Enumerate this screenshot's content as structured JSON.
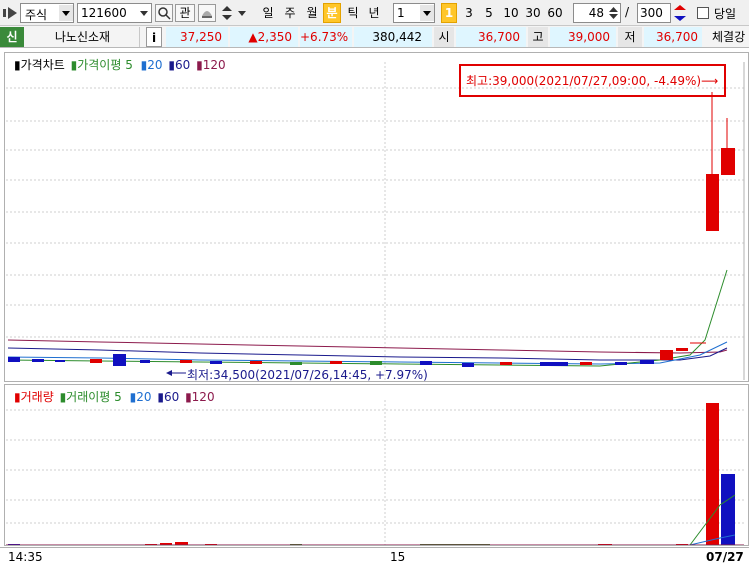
{
  "toolbar": {
    "market_type": "주식",
    "code": "121600",
    "interest_label": "관",
    "period_buttons": [
      "일",
      "주",
      "월",
      "분",
      "틱",
      "년"
    ],
    "active_period": "분",
    "interval_value": "1",
    "quick_intervals": [
      "1",
      "3",
      "5",
      "10",
      "30",
      "60"
    ],
    "active_quick": "1",
    "count_value": "48",
    "count_sep": "/",
    "count_total": "300",
    "today_label": "당일"
  },
  "quote": {
    "credit_badge": "신",
    "name": "나노신소재",
    "info_label": "i",
    "price": "37,250",
    "change": "▲2,350",
    "change_pct": "+6.73%",
    "volume": "380,442",
    "open_label": "시",
    "open": "36,700",
    "high_label": "고",
    "high": "39,000",
    "low_label": "저",
    "low": "36,700",
    "exec_label": "체결강"
  },
  "price_chart": {
    "legend": [
      {
        "label": "가격차트",
        "color": "#000000"
      },
      {
        "label": "가격이평 5",
        "color": "#2c8c2c"
      },
      {
        "label": "20",
        "color": "#1f6fd0"
      },
      {
        "label": "60",
        "color": "#1a1a8c"
      },
      {
        "label": "120",
        "color": "#8c1a4c"
      }
    ],
    "max_annotation": "최고:39,000(2021/07/27,09:00, -4.49%)",
    "min_annotation": "최저:34,500(2021/07/26,14:45, +7.97%)"
  },
  "volume_chart": {
    "legend": [
      {
        "label": "거래량",
        "color": "#e00000"
      },
      {
        "label": "거래이평 5",
        "color": "#2c8c2c"
      },
      {
        "label": "20",
        "color": "#1f6fd0"
      },
      {
        "label": "60",
        "color": "#1a1a8c"
      },
      {
        "label": "120",
        "color": "#8c1a4c"
      }
    ]
  },
  "x_axis": {
    "labels": [
      "14:35",
      "15",
      "07/27"
    ]
  },
  "colors": {
    "up": "#e00000",
    "down": "#1010c0",
    "annotation_box": "#e00000"
  }
}
